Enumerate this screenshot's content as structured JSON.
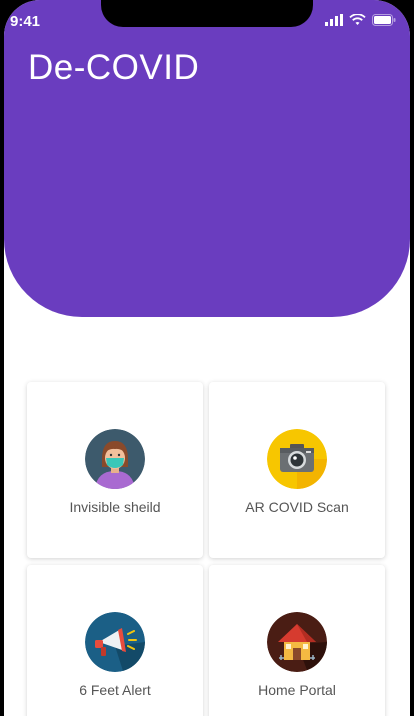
{
  "status_bar": {
    "time": "9:41"
  },
  "app": {
    "title": "De-COVID"
  },
  "cards": [
    {
      "label": "Invisible sheild",
      "icon": "masked-person-icon"
    },
    {
      "label": "AR COVID Scan",
      "icon": "camera-icon"
    },
    {
      "label": "6 Feet Alert",
      "icon": "megaphone-icon"
    },
    {
      "label": "Home Portal",
      "icon": "house-icon"
    }
  ],
  "colors": {
    "header": "#6a3dbf",
    "background": "#ffffff"
  }
}
